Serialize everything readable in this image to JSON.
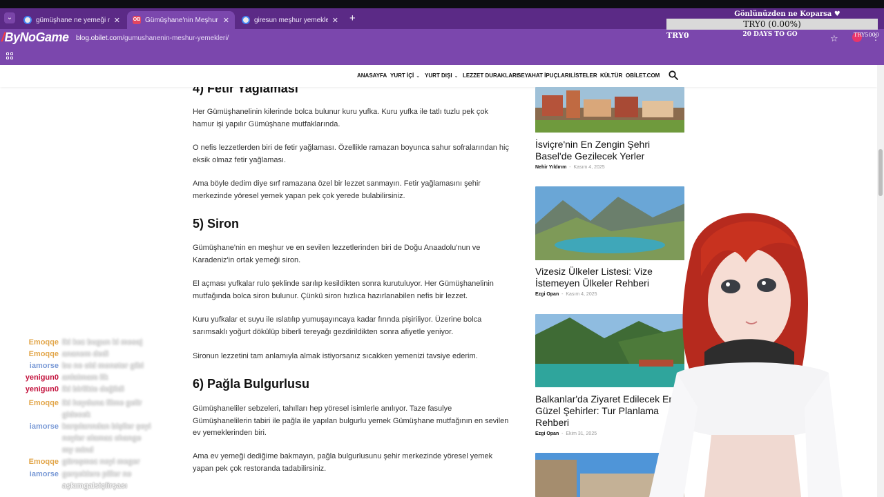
{
  "browser": {
    "tabs": [
      {
        "label": "gümüşhane ne yemeği meşhur",
        "favicon": "google-icon"
      },
      {
        "label": "Gümüşhane'nin Meşhur Lezzetleri",
        "favicon": "obilet-icon",
        "favicon_text": "OB"
      },
      {
        "label": "giresun meşhur yemekleri - Google",
        "favicon": "google-icon"
      }
    ],
    "url_host": "blog.obilet.com",
    "url_path": "/gumushanenin-meshur-yemekleri/",
    "brand": "ByNoGame"
  },
  "overlay": {
    "title": "Gönlünüzden ne Koparsa ♥",
    "bar": "TRY0 (0.00%)",
    "left": "TRY0",
    "mid": "20 DAYS TO GO",
    "right": "TRY5000"
  },
  "site_nav": {
    "items": [
      "ANASAYFA",
      "YURT İÇİ",
      "YURT DIŞI",
      "LEZZET DURAKLARI",
      "SEYAHAT İPUÇLARI",
      "LİSTELER",
      "KÜLTÜR",
      "OBİLET.COM"
    ]
  },
  "article": {
    "h4": "4) Fetir Yağlaması",
    "p1": "Her Gümüşhanelinin kilerinde bolca bulunur kuru yufka. Kuru yufka ile tatlı tuzlu pek çok hamur işi yapılır Gümüşhane mutfaklarında.",
    "p2": "O nefis lezzetlerden biri de fetir yağlaması. Özellikle ramazan boyunca sahur sofralarından hiç eksik olmaz fetir yağlaması.",
    "p3": "Ama böyle dedim diye sırf ramazana özel bir lezzet sanmayın. Fetir yağlamasını şehir merkezinde yöresel yemek yapan pek çok yerede bulabilirsiniz.",
    "h5": "5) Siron",
    "p4": "Gümüşhane'nin en meşhur ve en sevilen lezzetlerinden biri de Doğu Anaadolu'nun ve Karadeniz'in ortak yemeği siron.",
    "p5": "El açması yufkalar rulo şeklinde sarılıp kesildikten sonra kurutuluyor. Her Gümüşhanelinin mutfağında bolca siron bulunur. Çünkü siron hızlıca hazırlanabilen nefis bir lezzet.",
    "p6": "Kuru yufkalar et suyu ile ıslatılıp yumuşayıncaya kadar fırında pişiriliyor. Üzerine bolca sarımsaklı yoğurt dökülüp biberli tereyağı gezdirildikten sonra afiyetle yeniyor.",
    "p7": "Sironun lezzetini tam anlamıyla almak istiyorsanız sıcakken yemenizi tavsiye ederim.",
    "h6": "6) Pağla Bulgurlusu",
    "p8": "Gümüşhaneliler sebzeleri, tahılları hep yöresel isimlerle anılıyor. Taze fasulye Gümüşhanelilerin tabiri ile pağla ile yapılan bulgurlu yemek Gümüşhane mutfağının en sevilen ev yemeklerinden biri.",
    "p9": "Ama ev yemeği dediğime bakmayın, pağla bulgurlusunu şehir merkezinde yöresel yemek yapan pek çok restoranda tadabilirsiniz."
  },
  "sidebar": {
    "cards": [
      {
        "title": "İsviçre'nin En Zengin Şehri Basel'de Gezilecek Yerler",
        "author": "Nehir Yıldırım",
        "date": "Kasım 4, 2025"
      },
      {
        "title": "Vizesiz Ülkeler Listesi: Vize İstemeyen Ülkeler Rehberi",
        "author": "Ezgi Opan",
        "date": "Kasım 4, 2025"
      },
      {
        "title": "Balkanlar'da Ziyaret Edilecek En Güzel Şehirler: Tur Planlama Rehberi",
        "author": "Ezgi Opan",
        "date": "Ekim 31, 2025"
      }
    ]
  },
  "chat": [
    {
      "user": "Emoqqe",
      "color": "#e2a64a",
      "msg": "iki kez bugun ki mesaj"
    },
    {
      "user": "Emoqqe",
      "color": "#e2a64a",
      "msg": "ananem dedi"
    },
    {
      "user": "iamorse",
      "color": "#7a9ad6",
      "msg": "bu ne old monster gibi"
    },
    {
      "user": "yenigun0",
      "color": "#c3123d",
      "msg": "anlatmam ilk"
    },
    {
      "user": "yenigun0",
      "color": "#c3123d",
      "msg": "iki birlikte değildi"
    },
    {
      "user": "Emoqqe",
      "color": "#e2a64a",
      "msg": "iki heyduna filme gelir"
    },
    {
      "user": "",
      "color": "#e2a64a",
      "msg": "gidecek"
    },
    {
      "user": "iamorse",
      "color": "#7a9ad6",
      "msg": "karşılarından bişiler şeyi"
    },
    {
      "user": "",
      "color": "#7a9ad6",
      "msg": "neyler olamaz change"
    },
    {
      "user": "",
      "color": "#7a9ad6",
      "msg": "my mind"
    },
    {
      "user": "Emoqqe",
      "color": "#e2a64a",
      "msg": "güreşmez neyi meger"
    },
    {
      "user": "iamorse",
      "color": "#7a9ad6",
      "msg": "gerçeklere piller ne"
    },
    {
      "user": "",
      "color": "#7a9ad6",
      "msg": "aşkımgalsiçlirşası"
    }
  ]
}
